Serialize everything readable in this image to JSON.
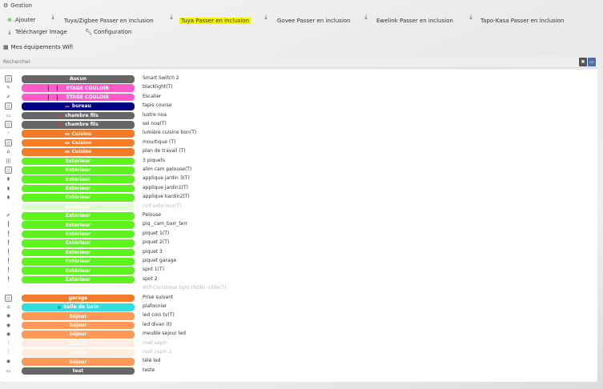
{
  "header": {
    "title": "Gestion"
  },
  "toolbar": {
    "add": "Ajouter",
    "tuya_zigbee": "Tuya/Zigbee Passer en inclusion",
    "tuya": "Tuya Passer en inclusion",
    "govee": "Govee Passer en inclusion",
    "ewelink": "Ewelink Passer en inclusion",
    "tapo": "Tapo-Kasa Passer en inclusion",
    "download_image": "Télécharger Image",
    "configuration": "Configuration"
  },
  "section": {
    "title": "Mes équipements Wifi"
  },
  "search": {
    "placeholder": "Rechercher",
    "clear": "✖",
    "toggle": "▭"
  },
  "colors": {
    "gris": "#666666",
    "rose": "#ff5acd",
    "marine": "#000080",
    "orange": "#f47c28",
    "vert": "#5ef21e",
    "cyan": "#33dede",
    "saumon": "#ff9955"
  },
  "rows": [
    {
      "icon": "▢",
      "object": "Aucun",
      "color": "gris",
      "name": "Smart Switch 2",
      "style": "plain"
    },
    {
      "icon": "✎",
      "object": "ETAGE COULOIR",
      "color": "rose",
      "name": "blacklight(T)",
      "style": "bars"
    },
    {
      "icon": "✐",
      "object": "ETAGE COULOIR",
      "color": "rose",
      "name": "Escalier",
      "style": "bars"
    },
    {
      "icon": "▢",
      "object": "bureau",
      "color": "marine",
      "name": "tapis course",
      "style": "red"
    },
    {
      "icon": "▭",
      "object": "chambre fils",
      "color": "gris",
      "name": "lustre noa",
      "style": "red"
    },
    {
      "icon": "▢",
      "object": "chambre fils",
      "color": "gris",
      "name": "sel noa(T)",
      "style": "red"
    },
    {
      "icon": "⁃",
      "object": "Cuisine",
      "color": "orange",
      "name": "lumière cuisine bon(T)",
      "style": "dot"
    },
    {
      "icon": "▢",
      "object": "Cuisine",
      "color": "orange",
      "name": "mourtique (T)",
      "style": "dot"
    },
    {
      "icon": "⌂",
      "object": "Cuisine",
      "color": "orange",
      "name": "plan de travail (T)",
      "style": "dot"
    },
    {
      "icon": "|||",
      "object": "Extérieur",
      "color": "vert",
      "name": "3 piquets",
      "style": "plain"
    },
    {
      "icon": "▢",
      "object": "Extérieur",
      "color": "vert",
      "name": "alim cam pelouse(T)",
      "style": "plain"
    },
    {
      "icon": "◖",
      "object": "Extérieur",
      "color": "vert",
      "name": "applique jardin 3(T)",
      "style": "plain"
    },
    {
      "icon": "◖",
      "object": "Extérieur",
      "color": "vert",
      "name": "applique jardin1(T)",
      "style": "plain"
    },
    {
      "icon": "◖",
      "object": "Extérieur",
      "color": "vert",
      "name": "applique kardin2(T)",
      "style": "plain"
    },
    {
      "icon": "·",
      "object": "Extérieur",
      "color": "vert",
      "name": "cinf exterieur(T)",
      "style": "plain",
      "disabled": true
    },
    {
      "icon": "✐",
      "object": "Extérieur",
      "color": "vert",
      "name": "Pelouse",
      "style": "plain"
    },
    {
      "icon": "┃",
      "object": "Extérieur",
      "color": "vert",
      "name": "piq _cam_barr_terr",
      "style": "plain"
    },
    {
      "icon": "╿",
      "object": "Extérieur",
      "color": "vert",
      "name": "piquet 1(T)",
      "style": "plain"
    },
    {
      "icon": "╿",
      "object": "Extérieur",
      "color": "vert",
      "name": "piquet 2(T)",
      "style": "plain"
    },
    {
      "icon": "╿",
      "object": "Extérieur",
      "color": "vert",
      "name": "piquet 3",
      "style": "plain"
    },
    {
      "icon": "╿",
      "object": "Extérieur",
      "color": "vert",
      "name": "piquet garage",
      "style": "plain"
    },
    {
      "icon": "╿",
      "object": "Extérieur",
      "color": "vert",
      "name": "spot 1(T)",
      "style": "plain"
    },
    {
      "icon": "╿",
      "object": "Extérieur",
      "color": "vert",
      "name": "spot 2",
      "style": "plain"
    },
    {
      "icon": "·",
      "object": "",
      "color": "none",
      "name": "Wifi Christmas light (RGB) -slide(T)",
      "style": "plain",
      "disabled": true
    },
    {
      "icon": "▢",
      "object": "garage",
      "color": "orange",
      "name": "Prise suivant",
      "style": "plain"
    },
    {
      "icon": "⌂",
      "object": "Salle de bain",
      "color": "cyan",
      "name": "plafonnier",
      "style": "green"
    },
    {
      "icon": "◉",
      "object": "Séjour",
      "color": "saumon",
      "name": "led coin tv(T)",
      "style": "plain"
    },
    {
      "icon": "◉",
      "object": "Séjour",
      "color": "saumon",
      "name": "led divan (t)",
      "style": "plain"
    },
    {
      "icon": "◉",
      "object": "Séjour",
      "color": "saumon",
      "name": "meuble sejour led",
      "style": "plain"
    },
    {
      "icon": "╿",
      "object": "Séjour",
      "color": "saumon",
      "name": "noël sapin",
      "style": "plain",
      "disabled": true
    },
    {
      "icon": "╿",
      "object": "Séjour",
      "color": "saumon",
      "name": "noël sapin 2",
      "style": "plain",
      "disabled": true
    },
    {
      "icon": "◉",
      "object": "Séjour",
      "color": "saumon",
      "name": "télé led",
      "style": "plain"
    },
    {
      "icon": "▭",
      "object": "test",
      "color": "gris",
      "name": "teste",
      "style": "plain"
    }
  ]
}
